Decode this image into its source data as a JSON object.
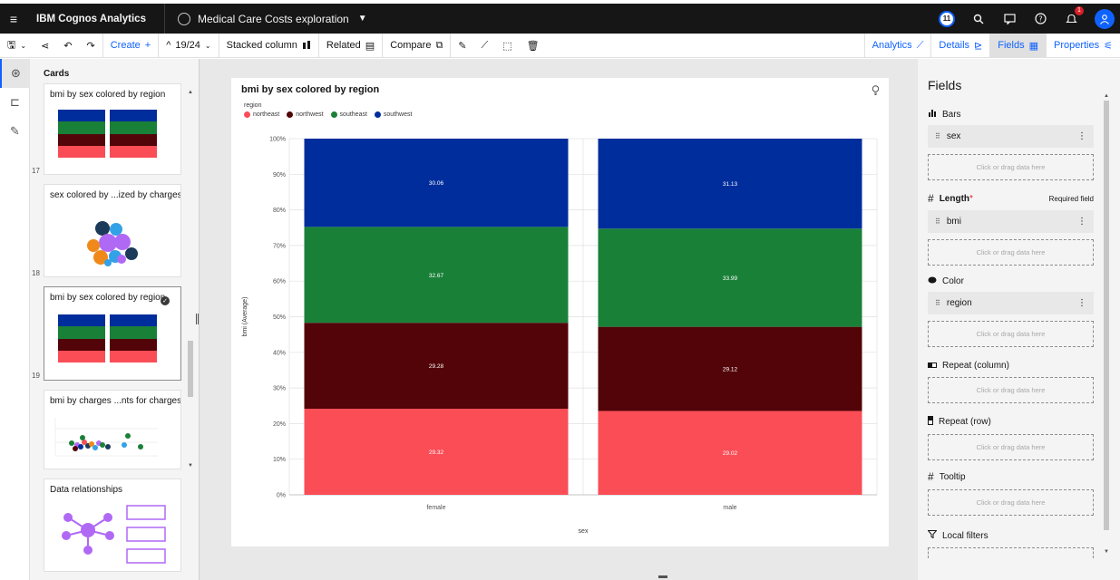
{
  "topbar": {
    "brand": "IBM Cognos Analytics",
    "workspace_title": "Medical Care Costs exploration",
    "user_badge": "11",
    "notification_count": "1"
  },
  "toolbar": {
    "create_label": "Create",
    "card_position": "19/24",
    "viz_label": "Stacked column",
    "related_label": "Related",
    "compare_label": "Compare",
    "tabs": [
      {
        "label": "Analytics"
      },
      {
        "label": "Details"
      },
      {
        "label": "Fields"
      },
      {
        "label": "Properties"
      }
    ]
  },
  "cards_panel": {
    "heading": "Cards",
    "cards": [
      {
        "title": "bmi by sex colored by region",
        "number": "17"
      },
      {
        "title": "sex colored by ...ized by charges",
        "number": "18"
      },
      {
        "title": "bmi by sex colored by region",
        "number": "19"
      },
      {
        "title": "bmi by charges ...nts for charges",
        "number": ""
      },
      {
        "title": "Data relationships",
        "number": ""
      }
    ]
  },
  "chart": {
    "title": "bmi by sex colored by region",
    "legend_title": "region",
    "colors": {
      "northeast": "#fa4d56",
      "northwest": "#520408",
      "southeast": "#198038",
      "southwest": "#002d9c"
    }
  },
  "chart_data": {
    "type": "bar",
    "stacked": true,
    "normalized": true,
    "title": "bmi by sex colored by region",
    "xlabel": "sex",
    "ylabel": "bmi (Average)",
    "categories": [
      "female",
      "male"
    ],
    "yticks": [
      "0%",
      "10%",
      "20%",
      "30%",
      "40%",
      "50%",
      "60%",
      "70%",
      "80%",
      "90%",
      "100%"
    ],
    "ylim": [
      0,
      100
    ],
    "series": [
      {
        "name": "northeast",
        "values": [
          29.32,
          29.02
        ]
      },
      {
        "name": "northwest",
        "values": [
          29.28,
          29.12
        ]
      },
      {
        "name": "southeast",
        "values": [
          32.67,
          33.99
        ]
      },
      {
        "name": "southwest",
        "values": [
          30.06,
          31.13
        ]
      }
    ],
    "legend_position": "top-left",
    "grid": true
  },
  "fields_panel": {
    "heading": "Fields",
    "required_label": "Required field",
    "drop_placeholder": "Click or drag data here",
    "sections": [
      {
        "label": "Bars",
        "value": "sex"
      },
      {
        "label": "Length",
        "value": "bmi"
      },
      {
        "label": "Color",
        "value": "region"
      },
      {
        "label": "Repeat (column)",
        "value": ""
      },
      {
        "label": "Repeat (row)",
        "value": ""
      },
      {
        "label": "Tooltip",
        "value": ""
      },
      {
        "label": "Local filters",
        "value": ""
      }
    ]
  }
}
